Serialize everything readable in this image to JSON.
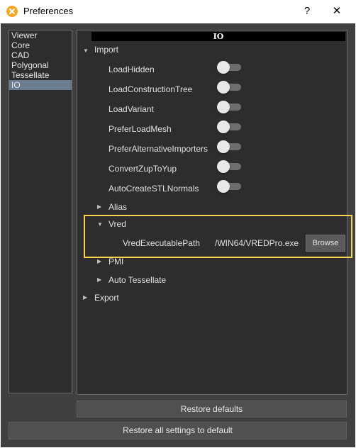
{
  "window": {
    "title": "Preferences",
    "help_glyph": "?",
    "close_glyph": "✕"
  },
  "categories": [
    {
      "label": "Viewer",
      "selected": false
    },
    {
      "label": "Core",
      "selected": false
    },
    {
      "label": "CAD",
      "selected": false
    },
    {
      "label": "Polygonal",
      "selected": false
    },
    {
      "label": "Tessellate",
      "selected": false
    },
    {
      "label": "IO",
      "selected": true
    }
  ],
  "panel": {
    "header": "IO",
    "import_label": "Import",
    "import_options": [
      {
        "label": "LoadHidden",
        "on": false
      },
      {
        "label": "LoadConstructionTree",
        "on": false
      },
      {
        "label": "LoadVariant",
        "on": false
      },
      {
        "label": "PreferLoadMesh",
        "on": false
      },
      {
        "label": "PreferAlternativeImporters",
        "on": false
      },
      {
        "label": "ConvertZupToYup",
        "on": false
      },
      {
        "label": "AutoCreateSTLNormals",
        "on": false
      }
    ],
    "alias_label": "Alias",
    "vred_label": "Vred",
    "vred_path_label": "VredExecutablePath",
    "vred_path_value": "/WIN64/VREDPro.exe",
    "browse_label": "Browse",
    "pmi_label": "PMI",
    "auto_tessellate_label": "Auto Tessellate",
    "export_label": "Export"
  },
  "buttons": {
    "restore_defaults": "Restore defaults",
    "restore_all": "Restore all settings to default"
  },
  "colors": {
    "accent_highlight": "#f5d34a",
    "app_icon": "#f5a623",
    "selected_item": "#6b7c8e"
  },
  "icons": {
    "expanded": "caret-down-icon",
    "collapsed": "caret-right-icon"
  }
}
